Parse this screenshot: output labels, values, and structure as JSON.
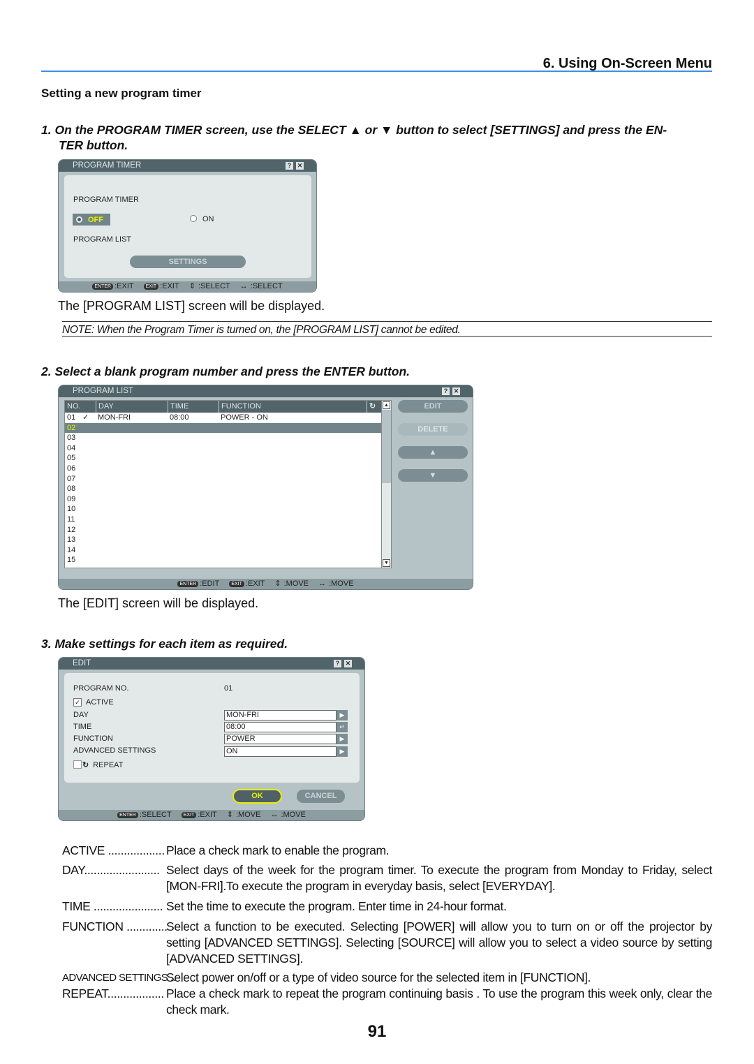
{
  "header": {
    "chapter": "6. Using On-Screen Menu",
    "section": "Setting a new program timer"
  },
  "step1": {
    "num": "1.",
    "text": "On the PROGRAM TIMER screen, use the SELECT ▲ or ▼ button to select [SETTINGS] and press the EN-",
    "text2": "TER button."
  },
  "dialog1": {
    "title": "PROGRAM TIMER",
    "label1": "PROGRAM TIMER",
    "off": "OFF",
    "on": "ON",
    "label2": "PROGRAM LIST",
    "settings": "SETTINGS",
    "footer": [
      {
        "key": "ENTER",
        "text": ":EXIT"
      },
      {
        "key": "EXIT",
        "text": ":EXIT"
      },
      {
        "key": "⇕",
        "text": ":SELECT"
      },
      {
        "key": "↔",
        "text": ":SELECT"
      }
    ]
  },
  "after1": "The [PROGRAM LIST] screen will be displayed.",
  "note": "NOTE: When the Program Timer is turned on, the [PROGRAM LIST] cannot be edited.",
  "step2": {
    "num": "2.",
    "text": "Select a blank program number and press the ENTER button."
  },
  "dialog2": {
    "title": "PROGRAM LIST",
    "columns": [
      "NO.",
      "DAY",
      "TIME",
      "FUNCTION"
    ],
    "rows": [
      {
        "no": "01",
        "check": "✓",
        "day": "MON-FRI",
        "time": "08:00",
        "function": "POWER - ON"
      },
      {
        "no": "02",
        "selected": true
      },
      {
        "no": "03"
      },
      {
        "no": "04"
      },
      {
        "no": "05"
      },
      {
        "no": "06"
      },
      {
        "no": "07"
      },
      {
        "no": "08"
      },
      {
        "no": "09"
      },
      {
        "no": "10"
      },
      {
        "no": "11"
      },
      {
        "no": "12"
      },
      {
        "no": "13"
      },
      {
        "no": "14"
      },
      {
        "no": "15"
      }
    ],
    "buttons": {
      "edit": "EDIT",
      "delete": "DELETE",
      "up": "▲",
      "down": "▼"
    },
    "footer": [
      {
        "key": "ENTER",
        "text": ":EDIT"
      },
      {
        "key": "EXIT",
        "text": ":EXIT"
      },
      {
        "key": "⇕",
        "text": ":MOVE"
      },
      {
        "key": "↔",
        "text": ":MOVE"
      }
    ]
  },
  "after2": "The [EDIT] screen will be displayed.",
  "step3": {
    "num": "3.",
    "text": "Make settings for each item as required."
  },
  "dialog3": {
    "title": "EDIT",
    "program_no_label": "PROGRAM NO.",
    "program_no": "01",
    "active": "ACTIVE",
    "active_checked": true,
    "day": "DAY",
    "day_value": "MON-FRI",
    "time": "TIME",
    "time_value": "08:00",
    "function": "FUNCTION",
    "function_value": "POWER",
    "advanced": "ADVANCED SETTINGS",
    "advanced_value": "ON",
    "repeat": "REPEAT",
    "repeat_checked": false,
    "ok": "OK",
    "cancel": "CANCEL",
    "footer": [
      {
        "key": "ENTER",
        "text": ":SELECT"
      },
      {
        "key": "EXIT",
        "text": ":EXIT"
      },
      {
        "key": "⇕",
        "text": ":MOVE"
      },
      {
        "key": "↔",
        "text": ":MOVE"
      }
    ]
  },
  "definitions": [
    {
      "term": "ACTIVE ..................",
      "desc": "Place a check mark to enable the program."
    },
    {
      "term": "DAY........................",
      "desc": "Select days of the week for the program timer. To execute the program from Monday to Friday, select [MON-FRI].To execute the program in everyday basis, select [EVERYDAY]."
    },
    {
      "term": "TIME ......................",
      "desc": "Set the time to execute the program. Enter time in 24-hour format."
    },
    {
      "term": "FUNCTION .............",
      "desc": "Select a function to be executed. Selecting [POWER] will allow you to turn on or off the projector by setting [ADVANCED SETTINGS]. Selecting [SOURCE] will allow you to select a video source by setting [ADVANCED SETTINGS]."
    },
    {
      "term": "ADVANCED SETTINGS ..",
      "desc": "Select power on/off or a type of video source for the selected item in [FUNCTION]."
    },
    {
      "term": "REPEAT..................",
      "desc": "Place a check mark to repeat the program continuing basis . To use the program this week only, clear the check mark."
    }
  ],
  "page_number": "91",
  "colors": {
    "rule": "#3d8fe6",
    "titlebar": "#51646a",
    "dialog": "#b5c3c7",
    "highlight": "#e8f000"
  }
}
